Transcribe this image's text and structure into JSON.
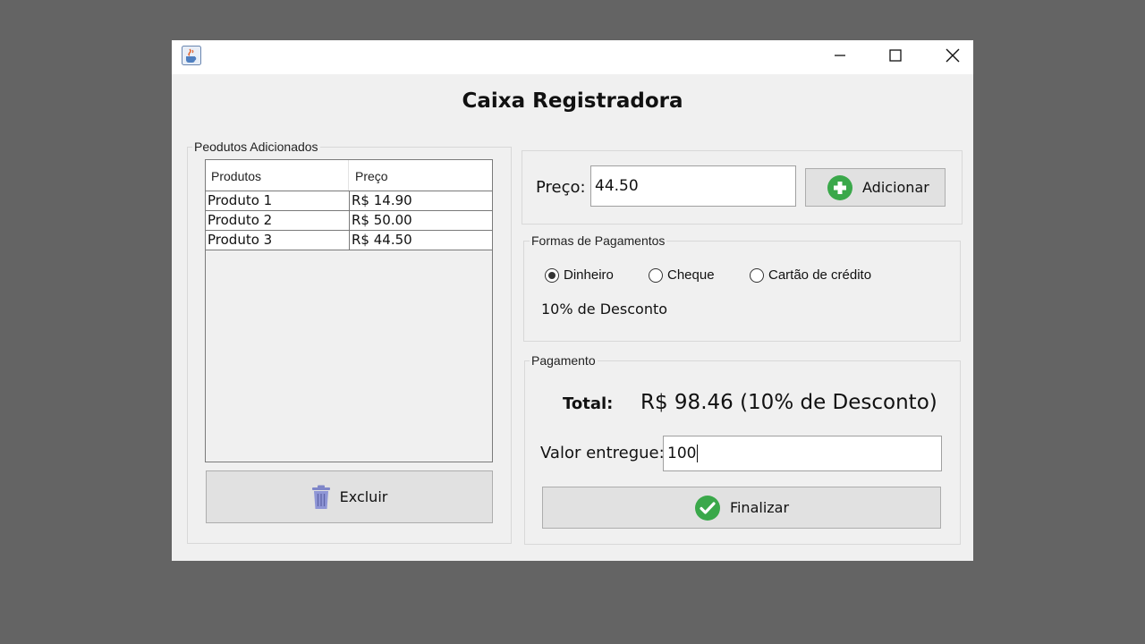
{
  "window": {
    "app_icon": "java-coffee-icon",
    "controls": {
      "minimize": "minimize-icon",
      "maximize": "maximize-icon",
      "close": "close-icon"
    }
  },
  "title": "Caixa Registradora",
  "products": {
    "legend": "Peodutos Adicionados",
    "columns": [
      "Produtos",
      "Preço"
    ],
    "rows": [
      {
        "name": "Produto 1",
        "price": "R$ 14.90"
      },
      {
        "name": "Produto 2",
        "price": "R$ 50.00"
      },
      {
        "name": "Produto 3",
        "price": "R$ 44.50"
      }
    ],
    "delete_button": {
      "label": "Excluir",
      "icon": "trash-icon"
    }
  },
  "price_entry": {
    "label": "Preço:",
    "value": "44.50",
    "add_button": {
      "label": "Adicionar",
      "icon": "plus-circle-icon"
    }
  },
  "payment_methods": {
    "legend": "Formas de Pagamentos",
    "options": [
      {
        "label": "Dinheiro",
        "selected": true
      },
      {
        "label": "Cheque",
        "selected": false
      },
      {
        "label": "Cartão de crédito",
        "selected": false
      }
    ],
    "discount_text": "10% de Desconto"
  },
  "payment": {
    "legend": "Pagamento",
    "total_label": "Total:",
    "total_value": "R$ 98.46 (10% de Desconto)",
    "tendered_label": "Valor entregue:",
    "tendered_value": "100",
    "finalize_button": {
      "label": "Finalizar",
      "icon": "check-circle-icon"
    }
  },
  "colors": {
    "background": "#646464",
    "window": "#f0f0f0",
    "add_icon": "#3aa84a",
    "finalize_icon": "#3aa84a",
    "trash_icon": "#7f86c8"
  }
}
